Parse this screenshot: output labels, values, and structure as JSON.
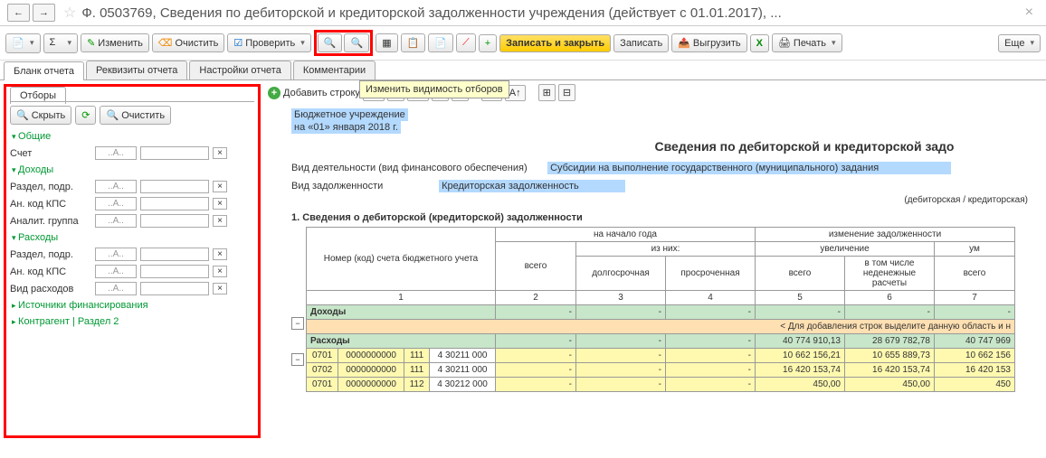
{
  "header": {
    "title": "Ф. 0503769, Сведения по дебиторской и кредиторской задолженности учреждения (действует с 01.01.2017), ..."
  },
  "toolbar": {
    "edit": "Изменить",
    "clear": "Очистить",
    "check": "Проверить",
    "save_close": "Записать и закрыть",
    "save": "Записать",
    "export": "Выгрузить",
    "print": "Печать",
    "more": "Еще"
  },
  "tabs": [
    "Бланк отчета",
    "Реквизиты отчета",
    "Настройки отчета",
    "Комментарии"
  ],
  "tooltip": "Изменить видимость отборов",
  "sidebar": {
    "tab": "Отборы",
    "hide": "Скрыть",
    "clear": "Очистить",
    "groups": {
      "common": "Общие",
      "income": "Доходы",
      "expense": "Расходы",
      "sources": "Источники финансирования",
      "counterparty": "Контрагент | Раздел 2"
    },
    "fields": {
      "account": "Счет",
      "section": "Раздел, подр.",
      "kps": "Ан. код КПС",
      "analyt": "Аналит. группа",
      "exp_type": "Вид расходов"
    },
    "placeholder": "..А.."
  },
  "main_toolbar": {
    "add_row": "Добавить строку"
  },
  "doc": {
    "org": "Бюджетное учреждение",
    "date": "на «01» января 2018 г.",
    "title": "Сведения по дебиторской и кредиторской задо",
    "activity_lbl": "Вид деятельности (вид финансового обеспечения)",
    "activity_val": "Субсидии на выполнение государственного (муниципального) задания",
    "debt_lbl": "Вид задолженности",
    "debt_val": "Кредиторская задолженность",
    "debt_note": "(дебиторская / кредиторская)",
    "section1": "1. Сведения о дебиторской (кредиторской) задолженности"
  },
  "table": {
    "h_account": "Номер (код) счета бюджетного учета",
    "h_start": "на начало года",
    "h_change": "изменение задолженности",
    "h_ofthem": "из них:",
    "h_increase": "увеличение",
    "h_decrease": "ум",
    "h_total": "всего",
    "h_longterm": "долгосрочная",
    "h_overdue": "просроченная",
    "h_noncash": "в том числе неденежные расчеты",
    "cols": [
      "1",
      "2",
      "3",
      "4",
      "5",
      "6",
      "7"
    ],
    "income": "Доходы",
    "expense": "Расходы",
    "add_note": "< Для добавления строк выделите данную область и н",
    "rows": [
      {
        "code": "0701",
        "acc": "0000000000",
        "sub": "111",
        "gl": "4 30211 000",
        "c5": "40 774 910,13",
        "c6": "28 679 782,78",
        "c7": "40 747 969"
      },
      {
        "code": "0701",
        "acc": "0000000000",
        "sub": "111",
        "gl": "4 30211 000",
        "c5": "10 662 156,21",
        "c6": "10 655 889,73",
        "c7": "10 662 156"
      },
      {
        "code": "0702",
        "acc": "0000000000",
        "sub": "111",
        "gl": "4 30211 000",
        "c5": "16 420 153,74",
        "c6": "16 420 153,74",
        "c7": "16 420 153"
      },
      {
        "code": "0701",
        "acc": "0000000000",
        "sub": "112",
        "gl": "4 30212 000",
        "c5": "450,00",
        "c6": "450,00",
        "c7": "450"
      }
    ]
  }
}
